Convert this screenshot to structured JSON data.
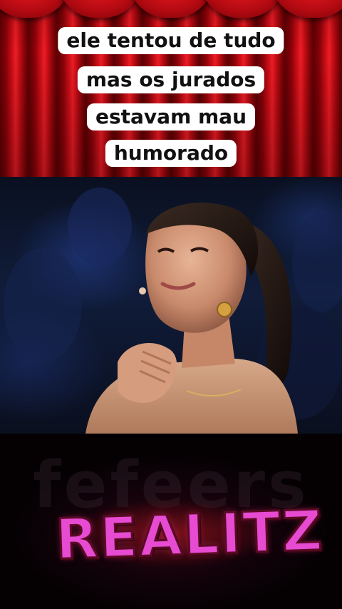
{
  "caption": {
    "lines": [
      "ele tentou de tudo",
      "mas os jurados",
      "estavam mau",
      "humorado"
    ]
  },
  "logo": {
    "watermark_text": "fefeers",
    "word": "REALITZ"
  },
  "colors": {
    "curtain_red": "#d4111b",
    "caption_bg": "#ffffff",
    "caption_text": "#111111",
    "logo_pink": "#e64bd2"
  }
}
